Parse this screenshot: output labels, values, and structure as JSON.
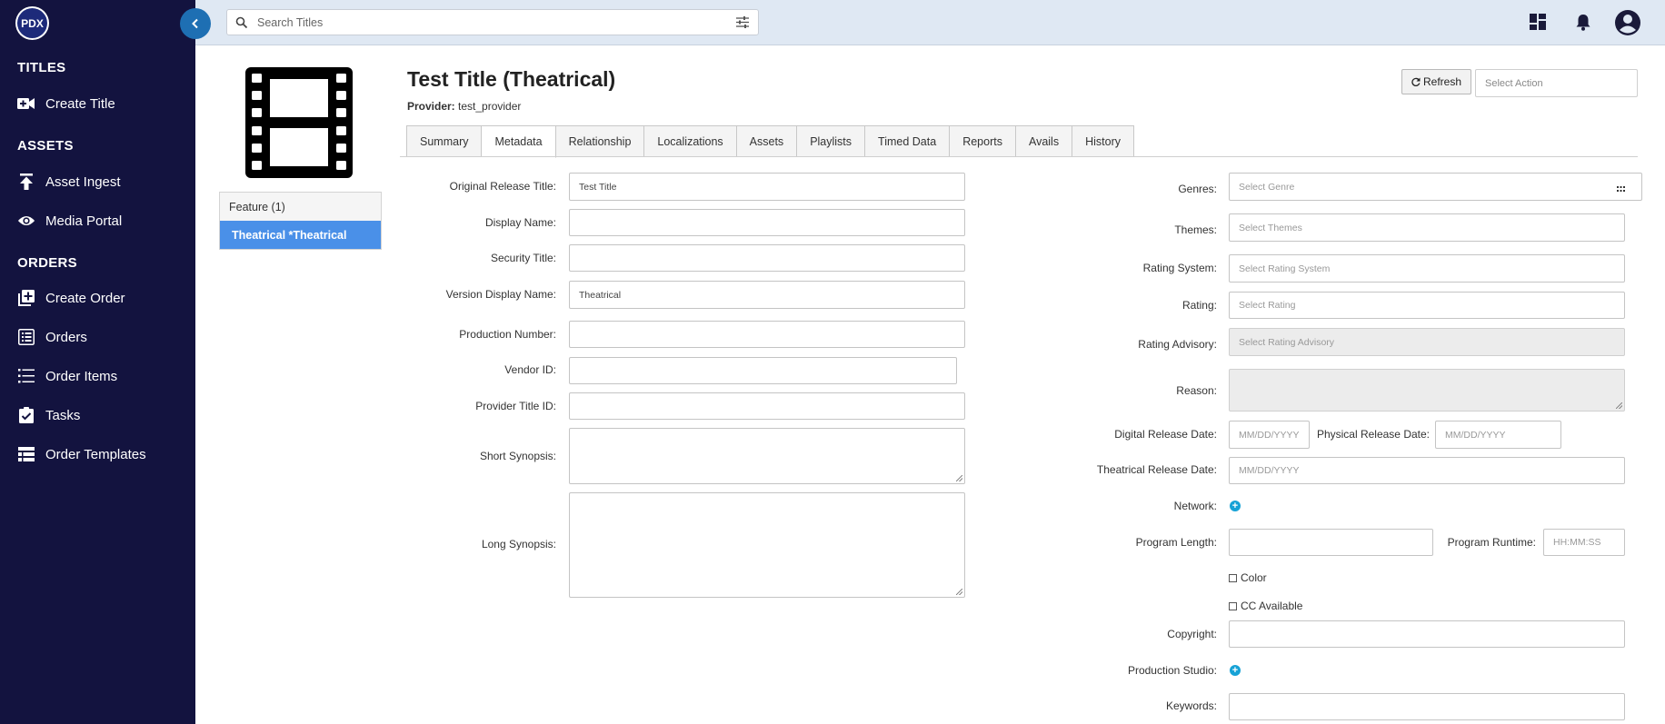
{
  "app": {
    "logo_text": "PDX"
  },
  "sidebar": {
    "sections": [
      {
        "title": "TITLES",
        "items": [
          {
            "label": "Create Title",
            "icon": "video-plus-icon"
          }
        ]
      },
      {
        "title": "ASSETS",
        "items": [
          {
            "label": "Asset Ingest",
            "icon": "upload-icon"
          },
          {
            "label": "Media Portal",
            "icon": "eye-icon"
          }
        ]
      },
      {
        "title": "ORDERS",
        "items": [
          {
            "label": "Create Order",
            "icon": "add-box-icon"
          },
          {
            "label": "Orders",
            "icon": "list-box-icon"
          },
          {
            "label": "Order Items",
            "icon": "list-icon"
          },
          {
            "label": "Tasks",
            "icon": "clipboard-check-icon"
          },
          {
            "label": "Order Templates",
            "icon": "table-icon"
          }
        ]
      }
    ]
  },
  "topbar": {
    "search_placeholder": "Search Titles",
    "icons": [
      "dashboard-icon",
      "bell-icon",
      "account-icon"
    ]
  },
  "title_panel": {
    "versions": {
      "header": "Feature (1)",
      "active": "Theatrical *Theatrical"
    }
  },
  "header": {
    "title": "Test Title (Theatrical)",
    "provider_label": "Provider:",
    "provider_value": "test_provider",
    "refresh_label": "Refresh",
    "select_action_placeholder": "Select Action"
  },
  "tabs": [
    "Summary",
    "Metadata",
    "Relationship",
    "Localizations",
    "Assets",
    "Playlists",
    "Timed Data",
    "Reports",
    "Avails",
    "History"
  ],
  "active_tab": "Metadata",
  "form_left": {
    "original_release_title": {
      "label": "Original Release Title:",
      "value": "Test Title"
    },
    "display_name": {
      "label": "Display Name:",
      "value": ""
    },
    "security_title": {
      "label": "Security Title:",
      "value": ""
    },
    "version_display_name": {
      "label": "Version Display Name:",
      "value": "Theatrical"
    },
    "production_number": {
      "label": "Production Number:",
      "value": ""
    },
    "vendor_id": {
      "label": "Vendor ID:",
      "value": ""
    },
    "provider_title_id": {
      "label": "Provider Title ID:",
      "value": ""
    },
    "short_synopsis": {
      "label": "Short Synopsis:",
      "value": ""
    },
    "long_synopsis": {
      "label": "Long Synopsis:",
      "value": ""
    }
  },
  "form_right": {
    "genres": {
      "label": "Genres:",
      "placeholder": "Select Genre"
    },
    "themes": {
      "label": "Themes:",
      "placeholder": "Select Themes"
    },
    "rating_system": {
      "label": "Rating System:",
      "placeholder": "Select Rating System"
    },
    "rating": {
      "label": "Rating:",
      "placeholder": "Select Rating"
    },
    "rating_advisory": {
      "label": "Rating Advisory:",
      "placeholder": "Select Rating Advisory"
    },
    "reason": {
      "label": "Reason:"
    },
    "digital_release_date": {
      "label": "Digital Release Date:",
      "placeholder": "MM/DD/YYYY"
    },
    "physical_release_date": {
      "label": "Physical Release Date:",
      "placeholder": "MM/DD/YYYY"
    },
    "theatrical_release_date": {
      "label": "Theatrical Release Date:",
      "placeholder": "MM/DD/YYYY"
    },
    "network": {
      "label": "Network:"
    },
    "program_length": {
      "label": "Program Length:",
      "value": ""
    },
    "program_runtime": {
      "label": "Program Runtime:",
      "placeholder": "HH:MM:SS"
    },
    "color": {
      "label": "Color",
      "checked": false
    },
    "cc_available": {
      "label": "CC Available",
      "checked": false
    },
    "copyright": {
      "label": "Copyright:",
      "value": ""
    },
    "production_studio": {
      "label": "Production Studio:"
    },
    "keywords": {
      "label": "Keywords:",
      "value": ""
    }
  },
  "colors": {
    "sidebar_bg": "#13133f",
    "topbar_bg": "#dfe8f3",
    "accent": "#4a90e8",
    "add_icon": "#16a2d6"
  }
}
